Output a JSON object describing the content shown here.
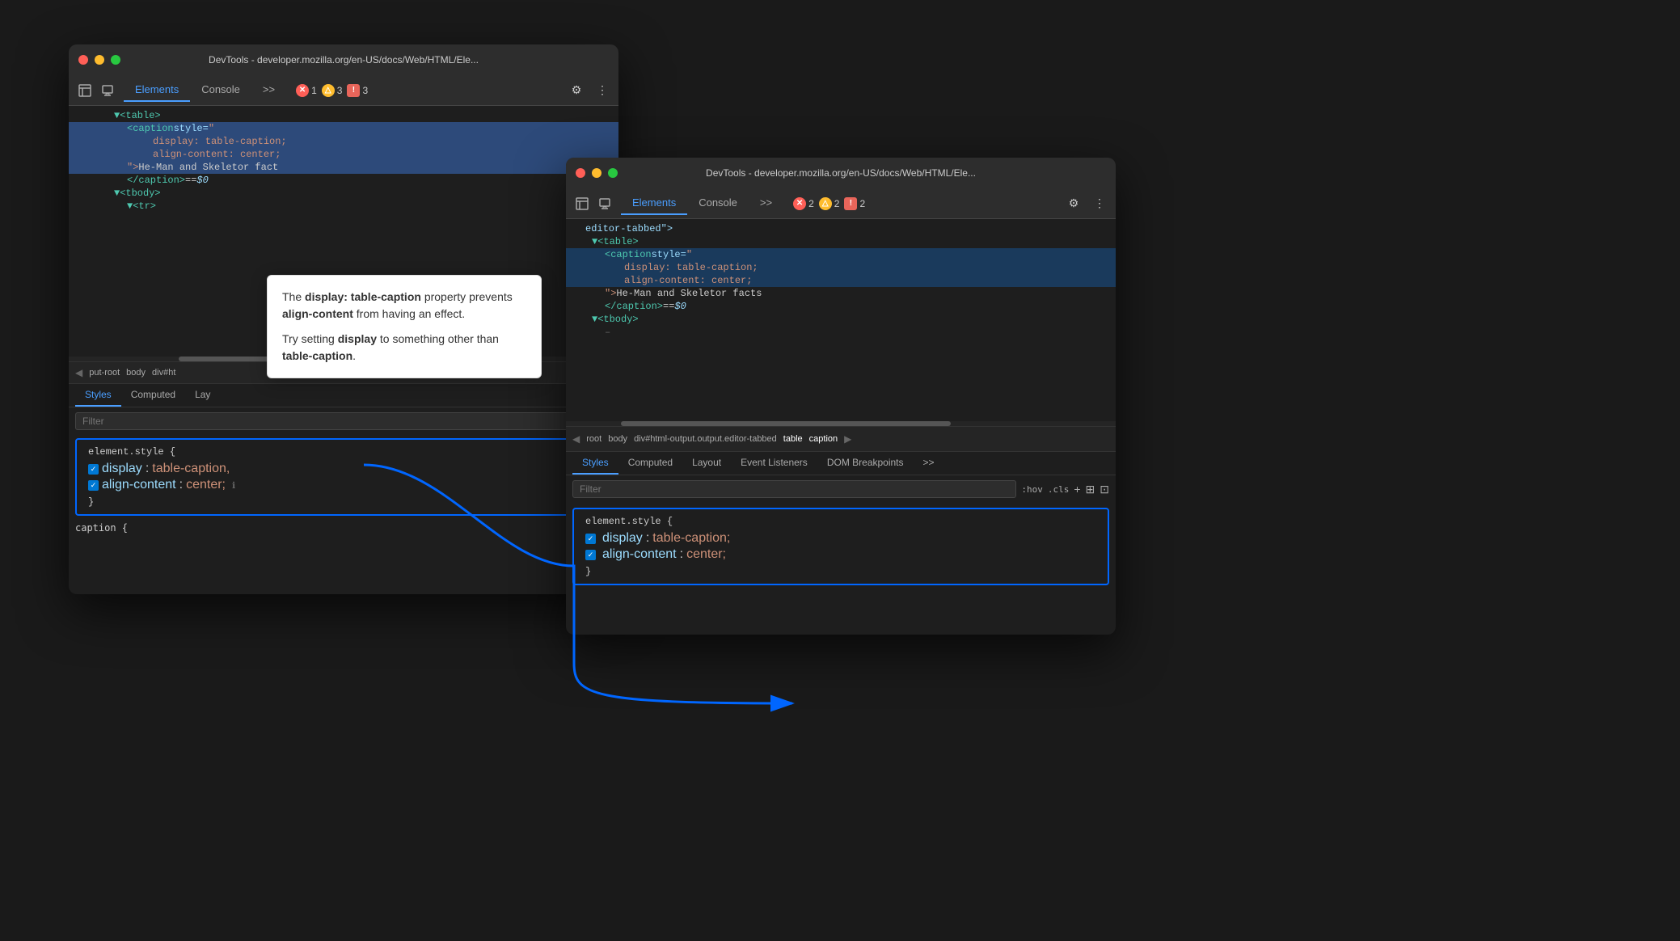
{
  "window1": {
    "title": "DevTools - developer.mozilla.org/en-US/docs/Web/HTML/Ele...",
    "tabs": [
      "Elements",
      "Console"
    ],
    "active_tab": "Elements",
    "more_tabs": ">>",
    "badges": [
      {
        "type": "error",
        "count": "1"
      },
      {
        "type": "warning",
        "count": "3"
      },
      {
        "type": "info",
        "count": "3"
      }
    ],
    "html_lines": [
      {
        "indent": 8,
        "content": "▼<table>",
        "selected": false
      },
      {
        "indent": 12,
        "content": "<caption style=\"",
        "selected": true
      },
      {
        "indent": 16,
        "content": "display: table-caption;",
        "selected": true
      },
      {
        "indent": 16,
        "content": "align-content: center;",
        "selected": true
      },
      {
        "indent": 12,
        "content": "\"> He-Man and Skeletor fact",
        "selected": true
      },
      {
        "indent": 12,
        "content": "</caption> == $0",
        "selected": false
      },
      {
        "indent": 8,
        "content": "▼<tbody>",
        "selected": false
      },
      {
        "indent": 12,
        "content": "▼<tr>",
        "selected": false
      }
    ],
    "breadcrumb": {
      "arrow": "◀",
      "items": [
        "put-root",
        "body",
        "div#ht"
      ]
    },
    "panel_tabs": [
      "Styles",
      "Computed",
      "Lay"
    ],
    "filter_placeholder": "Filter",
    "element_style": {
      "selector": "element.style {",
      "properties": [
        {
          "name": "display",
          "value": "table-caption,"
        },
        {
          "name": "align-content",
          "value": "center;"
        }
      ],
      "close": "}"
    },
    "extra_rule": "caption {"
  },
  "window2": {
    "title": "DevTools - developer.mozilla.org/en-US/docs/Web/HTML/Ele...",
    "tabs": [
      "Elements",
      "Console"
    ],
    "active_tab": "Elements",
    "more_tabs": ">>",
    "badges": [
      {
        "type": "error",
        "count": "2"
      },
      {
        "type": "warning",
        "count": "2"
      },
      {
        "type": "info",
        "count": "2"
      }
    ],
    "html_lines": [
      {
        "indent": 4,
        "content": "editor-tabbed\">",
        "selected": false
      },
      {
        "indent": 6,
        "content": "▼<table>",
        "selected": false
      },
      {
        "indent": 8,
        "content": "<caption style=\"",
        "selected": true
      },
      {
        "indent": 12,
        "content": "display: table-caption;",
        "selected": true
      },
      {
        "indent": 12,
        "content": "align-content: center;",
        "selected": true
      },
      {
        "indent": 8,
        "content": "\"> He-Man and Skeletor facts",
        "selected": false
      },
      {
        "indent": 8,
        "content": "</caption> == $0",
        "selected": false
      },
      {
        "indent": 6,
        "content": "▼<tbody>",
        "selected": false
      },
      {
        "indent": 8,
        "content": "–",
        "selected": false
      }
    ],
    "breadcrumb": {
      "arrow": "◀",
      "items": [
        "root",
        "body",
        "div#html-output.output.editor-tabbed",
        "table",
        "caption"
      ],
      "arrow_right": "▶"
    },
    "panel_tabs": [
      "Styles",
      "Computed",
      "Layout",
      "Event Listeners",
      "DOM Breakpoints",
      ">>"
    ],
    "active_panel_tab": "Styles",
    "filter_placeholder": "Filter",
    "filter_right_icons": [
      ":hov",
      ".cls",
      "+",
      "⊞",
      "⊡"
    ],
    "element_style": {
      "selector": "element.style {",
      "properties": [
        {
          "name": "display",
          "value": "table-caption;"
        },
        {
          "name": "align-content",
          "value": "center;"
        }
      ],
      "close": "}"
    }
  },
  "explanation": {
    "paragraph1_pre": "The ",
    "paragraph1_bold1": "display: table-caption",
    "paragraph1_post": " property prevents ",
    "paragraph1_bold2": "align-content",
    "paragraph1_end": " from having an effect.",
    "paragraph2_pre": "Try setting ",
    "paragraph2_bold": "display",
    "paragraph2_post": " to something other than ",
    "paragraph2_bold2": "table-caption",
    "paragraph2_end": "."
  },
  "icons": {
    "inspector": "⬚",
    "device": "⬜",
    "gear": "⚙",
    "more": "⋮",
    "more_tabs": ">>"
  }
}
